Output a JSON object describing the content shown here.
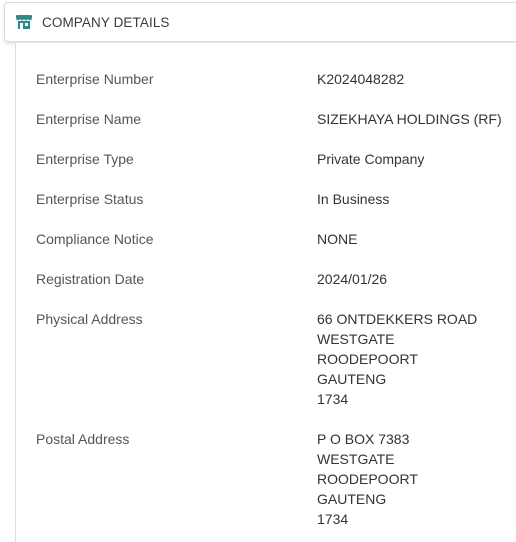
{
  "header": {
    "title": "COMPANY DETAILS",
    "icon": "storefront-icon",
    "icon_color": "#2f8b8b"
  },
  "details": [
    {
      "label": "Enterprise Number",
      "lines": [
        "K2024048282"
      ]
    },
    {
      "label": "Enterprise Name",
      "lines": [
        "SIZEKHAYA HOLDINGS (RF)"
      ]
    },
    {
      "label": "Enterprise Type",
      "lines": [
        "Private Company"
      ]
    },
    {
      "label": "Enterprise Status",
      "lines": [
        "In Business"
      ]
    },
    {
      "label": "Compliance Notice",
      "lines": [
        "NONE"
      ]
    },
    {
      "label": "Registration Date",
      "lines": [
        "2024/01/26"
      ]
    },
    {
      "label": "Physical Address",
      "lines": [
        "66 ONTDEKKERS ROAD",
        "WESTGATE",
        "ROODEPOORT",
        "GAUTENG",
        "1734"
      ]
    },
    {
      "label": "Postal Address",
      "lines": [
        "P O BOX 7383",
        "WESTGATE",
        "ROODEPOORT",
        "GAUTENG",
        "1734"
      ]
    }
  ]
}
